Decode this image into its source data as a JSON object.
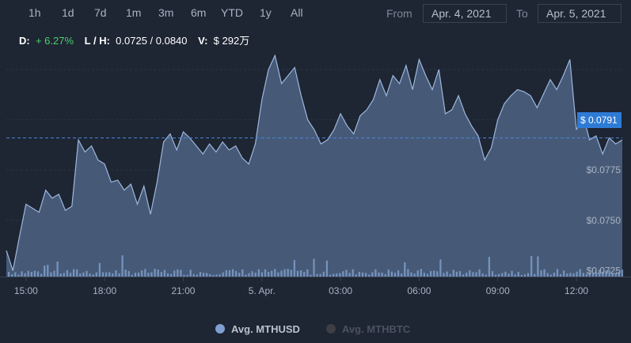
{
  "ranges": [
    "1h",
    "1d",
    "7d",
    "1m",
    "3m",
    "6m",
    "YTD",
    "1y",
    "All"
  ],
  "date_range": {
    "from_label": "From",
    "from_value": "Apr. 4, 2021",
    "to_label": "To",
    "to_value": "Apr. 5, 2021"
  },
  "stats": {
    "d_label": "D:",
    "d_value": "+ 6.27%",
    "lh_label": "L / H:",
    "lh_value": "0.0725 / 0.0840",
    "v_label": "V:",
    "v_value": "$ 292万"
  },
  "current_price_label": "$ 0.0791",
  "legend": {
    "series1": "Avg. MTHUSD",
    "series2": "Avg. MTHBTC"
  },
  "colors": {
    "background": "#1e2533",
    "line": "#9db8dd",
    "area": "#4d6485",
    "volume": "#86a8d6",
    "accent": "#2e7bd6",
    "up": "#4cd16a"
  },
  "chart_data": {
    "type": "area",
    "xlabel": "",
    "ylabel": "",
    "x_ticks": [
      "15:00",
      "18:00",
      "21:00",
      "5. Apr.",
      "03:00",
      "06:00",
      "09:00",
      "12:00"
    ],
    "y_ticks": [
      "$0.0725",
      "$0.0750",
      "$0.0775"
    ],
    "ylim": [
      0.0722,
      0.0836
    ],
    "grid": true,
    "current_value": 0.0791,
    "series": [
      {
        "name": "Avg. MTHUSD",
        "x": [
          "Apr. 4 14:15",
          "14:30",
          "14:45",
          "15:00",
          "15:15",
          "15:30",
          "15:45",
          "16:00",
          "16:15",
          "16:30",
          "16:45",
          "17:00",
          "17:15",
          "17:30",
          "17:45",
          "18:00",
          "18:15",
          "18:30",
          "18:45",
          "19:00",
          "19:15",
          "19:30",
          "19:45",
          "20:00",
          "20:15",
          "20:30",
          "20:45",
          "21:00",
          "21:15",
          "21:30",
          "21:45",
          "22:00",
          "22:15",
          "22:30",
          "22:45",
          "23:00",
          "23:15",
          "23:30",
          "23:45",
          "Apr. 5 00:00",
          "00:15",
          "00:30",
          "00:45",
          "01:00",
          "01:15",
          "01:30",
          "01:45",
          "02:00",
          "02:15",
          "02:30",
          "02:45",
          "03:00",
          "03:15",
          "03:30",
          "03:45",
          "04:00",
          "04:15",
          "04:30",
          "04:45",
          "05:00",
          "05:15",
          "05:30",
          "05:45",
          "06:00",
          "06:15",
          "06:30",
          "06:45",
          "07:00",
          "07:15",
          "07:30",
          "07:45",
          "08:00",
          "08:15",
          "08:30",
          "08:45",
          "09:00",
          "09:15",
          "09:30",
          "09:45",
          "10:00",
          "10:15",
          "10:30",
          "10:45",
          "11:00",
          "11:15",
          "11:30",
          "11:45",
          "12:00",
          "12:15",
          "12:30",
          "12:45",
          "13:00",
          "13:15",
          "13:30",
          "13:45"
        ],
        "values": [
          0.0735,
          0.0725,
          0.0742,
          0.0758,
          0.0756,
          0.0754,
          0.0765,
          0.0761,
          0.0763,
          0.0755,
          0.0757,
          0.079,
          0.0784,
          0.0787,
          0.078,
          0.0778,
          0.0769,
          0.077,
          0.0765,
          0.0768,
          0.0758,
          0.0767,
          0.0753,
          0.0769,
          0.0789,
          0.0793,
          0.0785,
          0.0794,
          0.0791,
          0.0787,
          0.0783,
          0.0788,
          0.0784,
          0.0789,
          0.0785,
          0.0787,
          0.0781,
          0.0778,
          0.0788,
          0.081,
          0.0825,
          0.0832,
          0.0818,
          0.0822,
          0.0826,
          0.0812,
          0.08,
          0.0795,
          0.0788,
          0.079,
          0.0795,
          0.0803,
          0.0797,
          0.0793,
          0.0802,
          0.0805,
          0.081,
          0.082,
          0.0812,
          0.0822,
          0.0818,
          0.0827,
          0.0815,
          0.083,
          0.0822,
          0.0815,
          0.0825,
          0.0803,
          0.0805,
          0.0812,
          0.0803,
          0.0797,
          0.0792,
          0.078,
          0.0786,
          0.08,
          0.0808,
          0.0812,
          0.0815,
          0.0814,
          0.0812,
          0.0806,
          0.0813,
          0.082,
          0.0815,
          0.0822,
          0.083,
          0.0795,
          0.0803,
          0.079,
          0.0792,
          0.0783,
          0.0791,
          0.0788,
          0.079
        ]
      },
      {
        "name": "Avg. MTHBTC",
        "x": [],
        "values": []
      }
    ]
  }
}
